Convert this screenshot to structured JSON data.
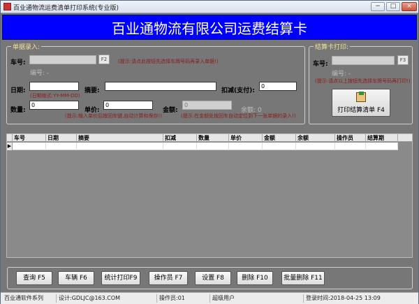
{
  "window": {
    "title": "百业通物流运费清单打印系统(专业版)",
    "minimize_glyph": "−",
    "maximize_glyph": "□",
    "close_glyph": "×"
  },
  "banner": {
    "title": "百业通物流有限公司运费结算卡"
  },
  "entry": {
    "group_label": "单据录入:",
    "plate_label": "车号:",
    "plate_value": "",
    "f2_label": "F2",
    "plate_hint": "(提示:请点此按钮先选择车牌号码再录入单据!)",
    "number_label": "编号: -",
    "date_label": "日期:",
    "date_value": "",
    "date_format": "(日期格式:YY-MM-DD)",
    "summary_label": "摘要:",
    "summary_value": "",
    "deduct_label": "扣减(支付):",
    "deduct_value": "0",
    "qty_label": "数量:",
    "qty_value": "0",
    "price_label": "单价:",
    "price_value": "0",
    "amount_label": "金额:",
    "amount_value": "0",
    "balance_label": "余额: 0",
    "hint_left": "(提示:输入单价后按回车键,自动计算和保存!)",
    "hint_right": "(提示:在金额处按回车自动定位到下一张单据的录入!)"
  },
  "print_card": {
    "group_label": "结算卡打印:",
    "plate_label": "车号:",
    "plate_value": "",
    "f3_label": "F3",
    "number_label": "编号: -",
    "hint": "(提示:请点以上按钮先选择车牌号码再打印!)",
    "print_button": "打印结算清单 F4"
  },
  "grid": {
    "columns": [
      "车号",
      "日期",
      "摘要",
      "扣减",
      "数量",
      "单价",
      "金额",
      "余额",
      "操作员",
      "结算期"
    ],
    "row_indicator": "▶"
  },
  "buttons": [
    "查询 F5",
    "车辆 F6",
    "统计打印F9",
    "操作员 F7",
    "设置 F8",
    "删除 F10",
    "批量删除 F11"
  ],
  "status": {
    "seg1": "百业通软件系列",
    "seg2": "设计:GDLJC@163.COM",
    "seg3": "操作员:01",
    "seg4": "超级用户",
    "seg5": "登录时间:2018-04-25  13:09"
  }
}
